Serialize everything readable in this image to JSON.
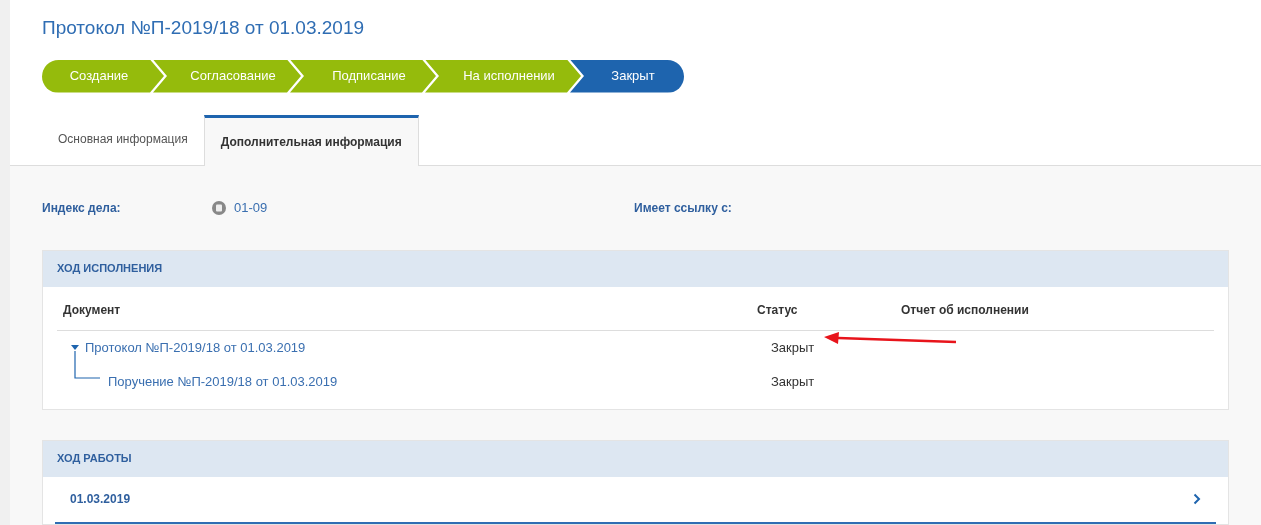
{
  "title": "Протокол №П-2019/18 от 01.03.2019",
  "stages": [
    {
      "label": "Создание",
      "kind": "done"
    },
    {
      "label": "Согласование",
      "kind": "done"
    },
    {
      "label": "Подписание",
      "kind": "done"
    },
    {
      "label": "На исполнении",
      "kind": "done"
    },
    {
      "label": "Закрыт",
      "kind": "current"
    }
  ],
  "tabs": [
    {
      "label": "Основная информация",
      "selected": false
    },
    {
      "label": "Дополнительная информация",
      "selected": true
    }
  ],
  "fields": [
    {
      "label": "Индекс дела:",
      "value": "01-09"
    },
    {
      "label": "Имеет ссылку с:"
    }
  ],
  "execution": {
    "title": "ХОД ИСПОЛНЕНИЯ",
    "columns": [
      "Документ",
      "Статус",
      "Отчет об исполнении"
    ],
    "rows": [
      {
        "document": "Протокол №П-2019/18 от 01.03.2019",
        "status": "Закрыт",
        "expanded": true,
        "children": [
          {
            "document": "Поручение №П-2019/18 от 01.03.2019",
            "status": "Закрыт"
          }
        ]
      }
    ]
  },
  "work": {
    "title": "ХОД РАБОТЫ",
    "items": [
      {
        "date": "01.03.2019"
      }
    ]
  }
}
